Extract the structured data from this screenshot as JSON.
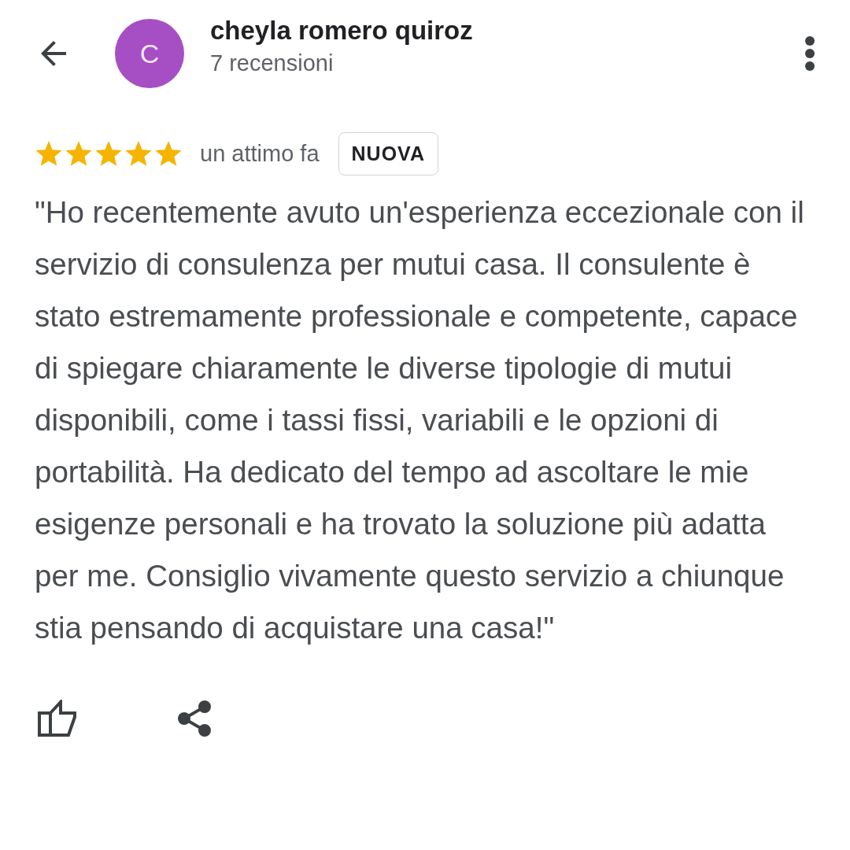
{
  "header": {
    "avatar_letter": "C",
    "name": "cheyla romero quiroz",
    "reviews_count": "7 recensioni"
  },
  "review": {
    "stars": 5,
    "time": "un attimo fa",
    "badge": "NUOVA",
    "text": "\"Ho recentemente avuto un'esperienza eccezionale con il servizio di consulenza per mutui casa. Il consulente è stato estremamente professionale e competente, capace di spiegare chiaramente le diverse tipologie di mutui disponibili, come i tassi fissi, variabili e le opzioni di portabilità. Ha dedicato del tempo ad ascoltare le mie esigenze personali e ha trovato la soluzione più adatta per me. Consiglio vivamente questo servizio a chiunque stia pensando di acquistare una casa!\""
  }
}
